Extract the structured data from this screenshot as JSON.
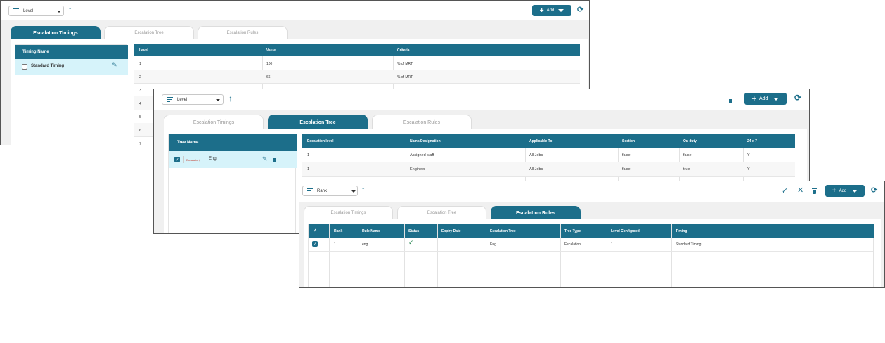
{
  "panel1": {
    "sort_label": "Level",
    "add_label": "Add",
    "tabs": [
      "Escalation Timings",
      "Escalation Tree",
      "Escalation Rules"
    ],
    "timing_header": "Timing Name",
    "timing_item": "Standard Timing",
    "columns": [
      "Level",
      "Value",
      "Criteria"
    ],
    "rows": [
      [
        "1",
        "100",
        "% of MRT"
      ],
      [
        "2",
        "66",
        "% of MRT"
      ],
      [
        "3",
        "",
        ""
      ],
      [
        "4",
        "",
        ""
      ],
      [
        "5",
        "",
        ""
      ],
      [
        "6",
        "",
        ""
      ],
      [
        "7",
        "",
        ""
      ]
    ]
  },
  "panel2": {
    "sort_label": "Level",
    "add_label": "Add",
    "tabs": [
      "Escalation Timings",
      "Escalation Tree",
      "Escalation Rules"
    ],
    "tree_header": "Tree Name",
    "tree_tag": "[Escalation]",
    "tree_item": "Eng",
    "columns": [
      "Escalation level",
      "Name/Designation",
      "Applicable To",
      "Section",
      "On duty",
      "24 x 7"
    ],
    "rows": [
      [
        "1",
        "Assigned staff",
        "All Jobs",
        "false",
        "false",
        "Y"
      ],
      [
        "1",
        "Engineer",
        "All Jobs",
        "false",
        "true",
        "Y"
      ]
    ]
  },
  "panel3": {
    "sort_label": "Rank",
    "add_label": "Add",
    "tabs": [
      "Escalation Timings",
      "Escalation Tree",
      "Escalation Rules"
    ],
    "columns": [
      "Rank",
      "Rule Name",
      "Status",
      "Expiry Date",
      "Escalation Tree",
      "Tree Type",
      "Level Configured",
      "Timing"
    ],
    "rows": [
      [
        "1",
        "eng",
        "",
        "",
        "Eng",
        "Escalation",
        "1",
        "Standard Timing"
      ]
    ]
  },
  "icons": {
    "sort": "sort-lines-icon",
    "up": "arrow-up-icon",
    "refresh": "refresh-icon",
    "delete": "trash-icon",
    "edit": "pencil-icon",
    "confirm": "check-icon",
    "cancel": "close-icon"
  },
  "colors": {
    "accent": "#1c6e8a",
    "selected_row": "#d6f3fa",
    "background": "#f0f0f0",
    "tag": "#c0392b"
  }
}
